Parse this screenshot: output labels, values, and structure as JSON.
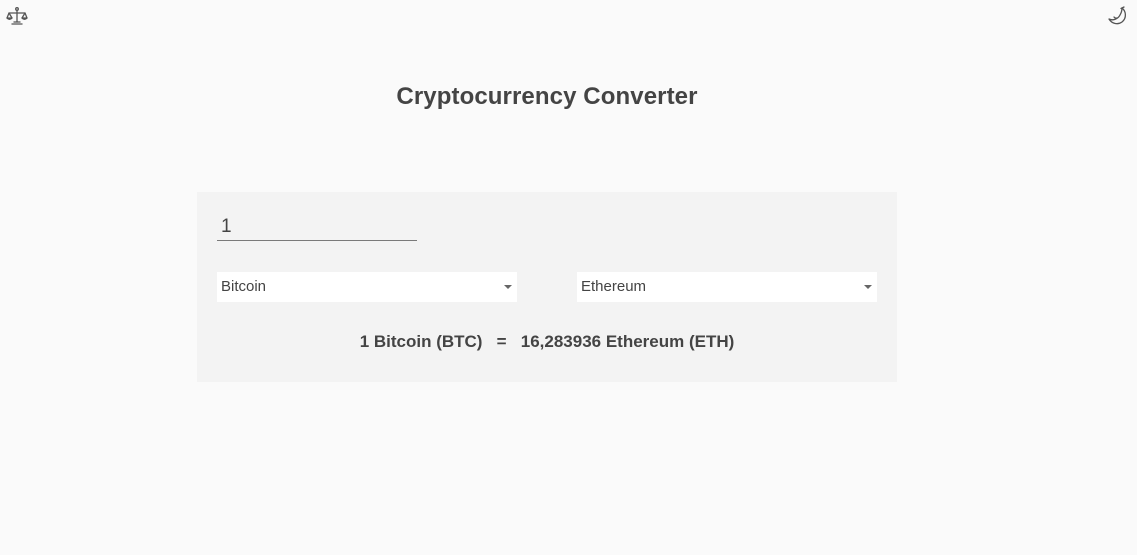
{
  "header": {
    "left_icon": "scale-icon",
    "right_icon": "moon-icon",
    "title": "Cryptocurrency Converter"
  },
  "converter": {
    "amount": "1",
    "from_currency": "Bitcoin",
    "to_currency": "Ethereum",
    "result": {
      "from_text": "1 Bitcoin (BTC)",
      "equals": "=",
      "to_text": "16,283936 Ethereum (ETH)"
    }
  },
  "colors": {
    "background": "#fafafa",
    "card": "#f3f3f3",
    "text": "#444444"
  }
}
